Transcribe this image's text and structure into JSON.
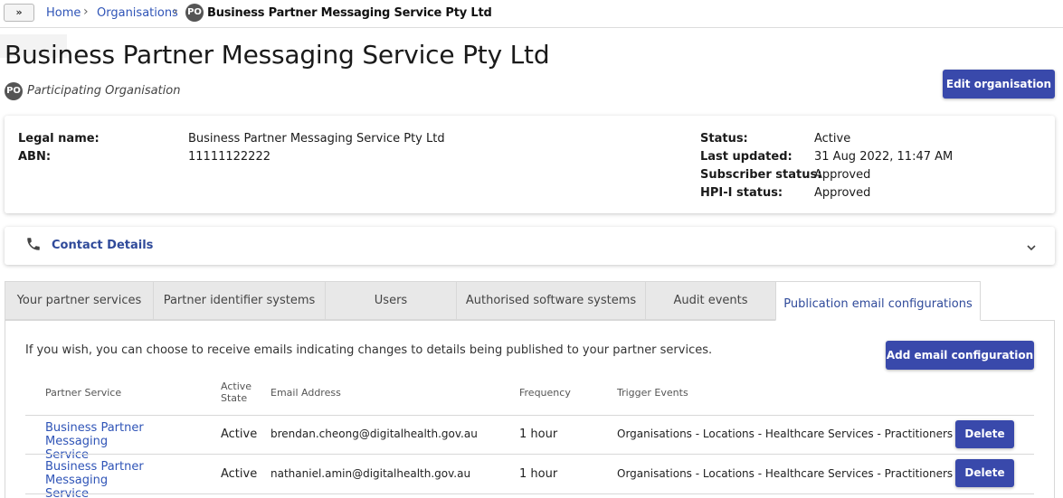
{
  "breadcrumb": {
    "expand_label": "»",
    "home": "Home",
    "organisations": "Organisations",
    "badge": "PO",
    "current": "Business Partner Messaging Service Pty Ltd"
  },
  "header": {
    "title": "Business Partner Messaging Service Pty Ltd",
    "badge": "PO",
    "org_type": "Participating Organisation",
    "edit_button": "Edit organisation"
  },
  "details": {
    "legal_name_label": "Legal name:",
    "legal_name": "Business Partner Messaging Service Pty Ltd",
    "abn_label": "ABN:",
    "abn": "11111122222",
    "status_label": "Status:",
    "status": "Active",
    "last_updated_label": "Last updated:",
    "last_updated": "31 Aug 2022, 11:47 AM",
    "subscriber_status_label": "Subscriber status:",
    "subscriber_status": "Approved",
    "hpii_status_label": "HPI-I status:",
    "hpii_status": "Approved"
  },
  "contact": {
    "title": "Contact Details",
    "icon": "phone-icon"
  },
  "tabs": [
    {
      "label": "Your partner services"
    },
    {
      "label": "Partner identifier systems"
    },
    {
      "label": "Users"
    },
    {
      "label": "Authorised software systems"
    },
    {
      "label": "Audit events"
    },
    {
      "label": "Publication email configurations"
    }
  ],
  "panel": {
    "intro": "If you wish, you can choose to receive emails indicating changes to details being published to your partner services.",
    "add_button": "Add email configuration",
    "columns": {
      "partner_service": "Partner Service",
      "active_state_1": "Active",
      "active_state_2": "State",
      "email": "Email Address",
      "frequency": "Frequency",
      "trigger": "Trigger Events"
    },
    "rows": [
      {
        "service_1": "Business Partner Messaging",
        "service_2": "Service",
        "state": "Active",
        "email": "brendan.cheong@digitalhealth.gov.au",
        "frequency": "1 hour",
        "trigger": "Organisations - Locations - Healthcare Services - Practitioners",
        "delete": "Delete"
      },
      {
        "service_1": "Business Partner Messaging",
        "service_2": "Service",
        "state": "Active",
        "email": "nathaniel.amin@digitalhealth.gov.au",
        "frequency": "1 hour",
        "trigger": "Organisations - Locations - Healthcare Services - Practitioners",
        "delete": "Delete"
      }
    ]
  },
  "colors": {
    "primary": "#3949ab",
    "link": "#2f54b7"
  }
}
